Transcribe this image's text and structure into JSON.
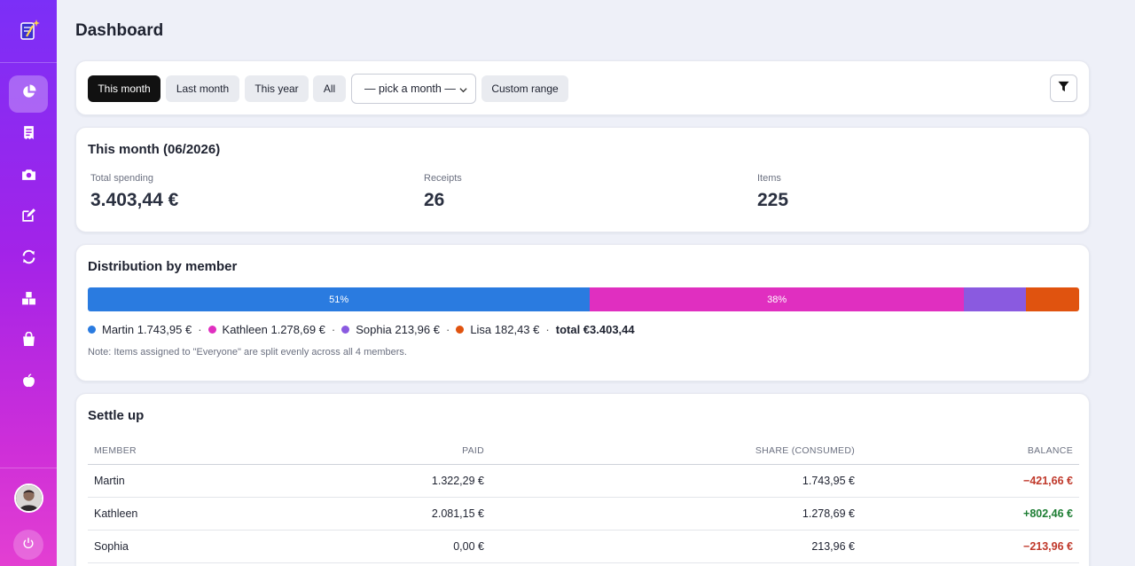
{
  "page": {
    "title": "Dashboard"
  },
  "sidebar": {
    "items": [
      {
        "icon": "pie-chart-icon",
        "active": true
      },
      {
        "icon": "receipt-icon"
      },
      {
        "icon": "camera-icon"
      },
      {
        "icon": "edit-icon"
      },
      {
        "icon": "sync-icon"
      },
      {
        "icon": "boxes-icon"
      },
      {
        "icon": "bag-icon"
      },
      {
        "icon": "apple-icon"
      }
    ]
  },
  "filters": {
    "buttons": [
      "This month",
      "Last month",
      "This year",
      "All"
    ],
    "select_value": "— pick a month —",
    "custom_range": "Custom range",
    "active": "This month"
  },
  "summary": {
    "title": "This month (06/2026)",
    "stats": [
      {
        "label": "Total spending",
        "value": "3.403,44 €"
      },
      {
        "label": "Receipts",
        "value": "26"
      },
      {
        "label": "Items",
        "value": "225"
      }
    ]
  },
  "distribution": {
    "title": "Distribution by member",
    "segments": [
      {
        "name": "Martin",
        "fraction": 0.51,
        "label": "51%",
        "color": "#2a7be0"
      },
      {
        "name": "Kathleen",
        "fraction": 0.38,
        "label": "38%",
        "color": "#e02fc0"
      },
      {
        "name": "Sophia",
        "fraction": 0.063,
        "label": "",
        "color": "#8a5ae0"
      },
      {
        "name": "Lisa",
        "fraction": 0.054,
        "label": "",
        "color": "#e0530f"
      }
    ],
    "legend": [
      {
        "text": "Martin 1.743,95 €",
        "color": "#2a7be0"
      },
      {
        "text": "Kathleen 1.278,69 €",
        "color": "#e02fc0"
      },
      {
        "text": "Sophia 213,96 €",
        "color": "#8a5ae0"
      },
      {
        "text": "Lisa 182,43 €",
        "color": "#e0530f"
      }
    ],
    "total": "total €3.403,44",
    "note": "Note: Items assigned to \"Everyone\" are split evenly across all 4 members."
  },
  "settle": {
    "title": "Settle up",
    "columns": [
      "MEMBER",
      "PAID",
      "SHARE (CONSUMED)",
      "BALANCE"
    ],
    "rows": [
      {
        "member": "Martin",
        "paid": "1.322,29 €",
        "share": "1.743,95 €",
        "balance": "−421,66 €",
        "status": "negative"
      },
      {
        "member": "Kathleen",
        "paid": "2.081,15 €",
        "share": "1.278,69 €",
        "balance": "+802,46 €",
        "status": "positive"
      },
      {
        "member": "Sophia",
        "paid": "0,00 €",
        "share": "213,96 €",
        "balance": "−213,96 €",
        "status": "negative"
      }
    ]
  }
}
